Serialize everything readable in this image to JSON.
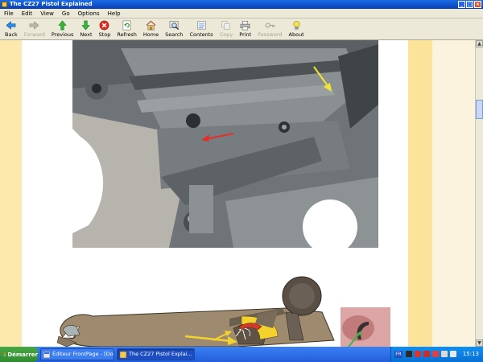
{
  "window": {
    "title": "The CZ27 Pistol Explained"
  },
  "menu": [
    "File",
    "Edit",
    "View",
    "Go",
    "Options",
    "Help"
  ],
  "toolbar": {
    "back": "Back",
    "forward": "Forward",
    "previous": "Previous",
    "next": "Next",
    "stop": "Stop",
    "refresh": "Refresh",
    "home": "Home",
    "search": "Search",
    "contents": "Contents",
    "copy": "Copy",
    "print": "Print",
    "password": "Password",
    "about": "About"
  },
  "taskbar": {
    "start": "Démarrer",
    "tasks": [
      "Éditeur FrontPage - [Do...",
      "The CZ27 Pistol Explai..."
    ],
    "tray_label": "FR",
    "clock": "15:13"
  },
  "colors": {
    "sidebar_yellow": "#fce39a",
    "diagram_body": "#9e8a6e",
    "arrow_yellow": "#f3e33a",
    "arrow_red": "#e43124",
    "arrow_green": "#3ab54a"
  }
}
